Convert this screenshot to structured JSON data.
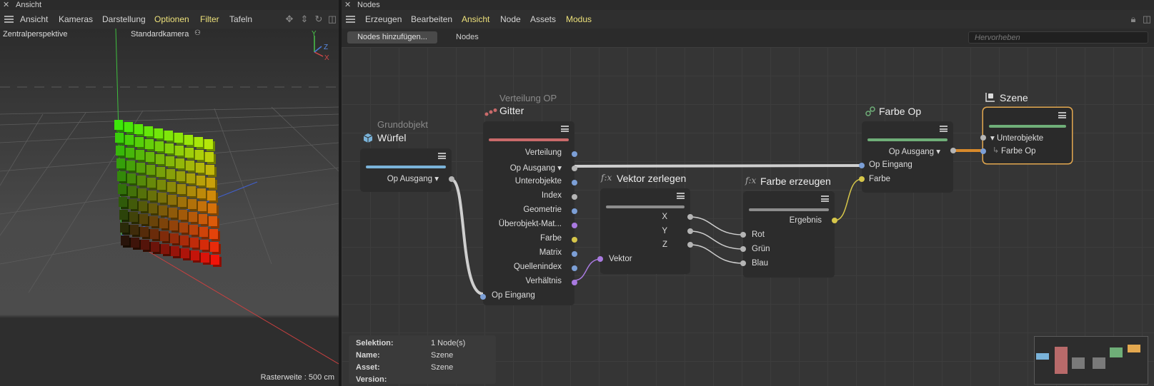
{
  "left_panel": {
    "title": "Ansicht",
    "menu": [
      "Ansicht",
      "Kameras",
      "Darstellung",
      "Optionen",
      "Filter",
      "Tafeln"
    ],
    "highlighted_menu": [
      "Optionen",
      "Filter"
    ],
    "viewport": {
      "projection_label": "Zentralperspektive",
      "camera_label": "Standardkamera",
      "axes": {
        "y": "Y",
        "z": "Z",
        "x": "X"
      },
      "grid_status": "Rasterweite : 500 cm"
    }
  },
  "right_panel": {
    "title": "Nodes",
    "menu": [
      "Erzeugen",
      "Bearbeiten",
      "Ansicht",
      "Node",
      "Assets",
      "Modus"
    ],
    "highlighted_menu": [
      "Ansicht",
      "Modus"
    ],
    "add_nodes_button": "Nodes hinzufügen...",
    "nodes_tab": "Nodes",
    "highlight_placeholder": "Hervorheben",
    "nodes": {
      "wuerfel": {
        "subtitle": "Grundobjekt",
        "title": "Würfel",
        "output": "Op Ausgang ▾",
        "icon": "cube-icon",
        "color": "#7ab3d9"
      },
      "gitter": {
        "subtitle": "Verteilung OP",
        "title": "Gitter",
        "icon": "distribution-icon",
        "color": "#c96a6a",
        "ports": [
          "Verteilung",
          "Op Ausgang ▾",
          "Unterobjekte",
          "Index",
          "Geometrie",
          "Überobjekt-Mat...",
          "Farbe",
          "Matrix",
          "Quellenindex",
          "Verhältnis"
        ],
        "input": "Op Eingang"
      },
      "vektor": {
        "title": "Vektor zerlegen",
        "prefix": "f:x",
        "outputs": [
          "X",
          "Y",
          "Z"
        ],
        "input": "Vektor"
      },
      "farbe_erzeugen": {
        "title": "Farbe erzeugen",
        "prefix": "f:x",
        "output": "Ergebnis",
        "inputs": [
          "Rot",
          "Grün",
          "Blau"
        ]
      },
      "farbe_op": {
        "title": "Farbe Op",
        "icon": "color-op-icon",
        "color": "#6fae78",
        "output": "Op Ausgang ▾",
        "inputs": [
          "Op Eingang",
          "Farbe"
        ]
      },
      "szene": {
        "title": "Szene",
        "icon": "scene-icon",
        "color": "#6fae78",
        "items": [
          "▾ Unterobjekte",
          "Farbe Op"
        ]
      }
    },
    "info": {
      "rows": [
        {
          "key": "Selektion:",
          "value": "1 Node(s)"
        },
        {
          "key": "Name:",
          "value": "Szene"
        },
        {
          "key": "Asset:",
          "value": "Szene"
        },
        {
          "key": "Version:",
          "value": ""
        }
      ]
    },
    "colors": {
      "port_blue": "#7c9fd6",
      "port_gray": "#b5b5b5",
      "port_purple": "#a97ae0",
      "port_yellow": "#d6c64a",
      "wire_gray": "#cfcfcf",
      "wire_orange": "#d88a2b",
      "selection": "#e3a84f"
    }
  }
}
